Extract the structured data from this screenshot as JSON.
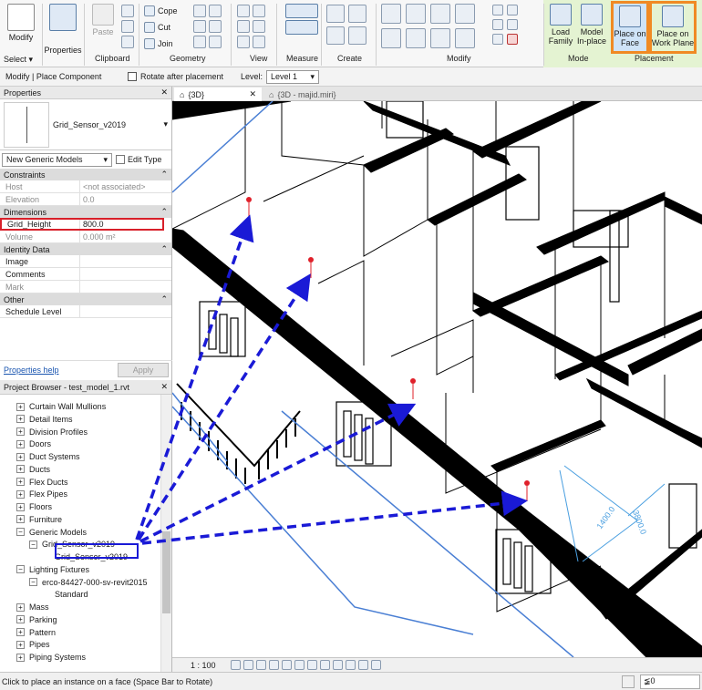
{
  "ribbon": {
    "modify": {
      "label": "Modify",
      "select": "Select ▾"
    },
    "properties": {
      "label": "Properties"
    },
    "clipboard": {
      "paste": "Paste",
      "label": "Clipboard"
    },
    "geometry": {
      "cope": "Cope",
      "cut": "Cut",
      "join": "Join",
      "label": "Geometry"
    },
    "view_label": "View",
    "measure": {
      "label": "Measure"
    },
    "create_label": "Create",
    "modify_group_label": "Modify",
    "mode": {
      "load_family": "Load\nFamily",
      "model_inplace": "Model\nIn-place",
      "label": "Mode"
    },
    "placement": {
      "place_on_face": "Place on\nFace",
      "place_on_work_plane": "Place on\nWork Plane",
      "label": "Placement"
    }
  },
  "options_bar": {
    "context": "Modify | Place Component",
    "rotate_after_placement": "Rotate after placement",
    "level_label": "Level:",
    "level_value": "Level 1"
  },
  "properties": {
    "title": "Properties",
    "family_name": "Grid_Sensor_v2019",
    "type_selector": "New Generic Models",
    "edit_type": "Edit Type",
    "sections": {
      "constraints": "Constraints",
      "dimensions": "Dimensions",
      "identity": "Identity Data",
      "other": "Other"
    },
    "rows": {
      "host_k": "Host",
      "host_v": "<not associated>",
      "elev_k": "Elevation",
      "elev_v": "0.0",
      "gh_k": "Grid_Height",
      "gh_v": "800.0",
      "vol_k": "Volume",
      "vol_v": "0.000 m²",
      "image_k": "Image",
      "comments_k": "Comments",
      "mark_k": "Mark",
      "sched_k": "Schedule Level"
    },
    "help": "Properties help",
    "apply": "Apply"
  },
  "browser": {
    "title": "Project Browser - test_model_1.rvt",
    "items": [
      "Curtain Wall Mullions",
      "Detail Items",
      "Division Profiles",
      "Doors",
      "Duct Systems",
      "Ducts",
      "Flex Ducts",
      "Flex Pipes",
      "Floors",
      "Furniture",
      "Generic Models",
      "Grid_Sensor_v2019",
      "Grid_Sensor_v2019",
      "Lighting Fixtures",
      "erco-84427-000-sv-revit2015",
      "Standard",
      "Mass",
      "Parking",
      "Pattern",
      "Pipes",
      "Piping Systems"
    ]
  },
  "tabs": {
    "active": "{3D}",
    "other": "{3D - majid.miri}"
  },
  "viewport": {
    "dim_a": "1400.0",
    "dim_b": "3800.0"
  },
  "view_control": {
    "scale": "1 : 100"
  },
  "status": {
    "message": "Click to place an instance on a face (Space Bar to Rotate)",
    "filter": "≨0"
  },
  "colors": {
    "highlight_orange": "#f08a24",
    "highlight_red": "#d8202a",
    "arrow_blue": "#1a1ad6",
    "mode_green": "#e4f3d2"
  }
}
